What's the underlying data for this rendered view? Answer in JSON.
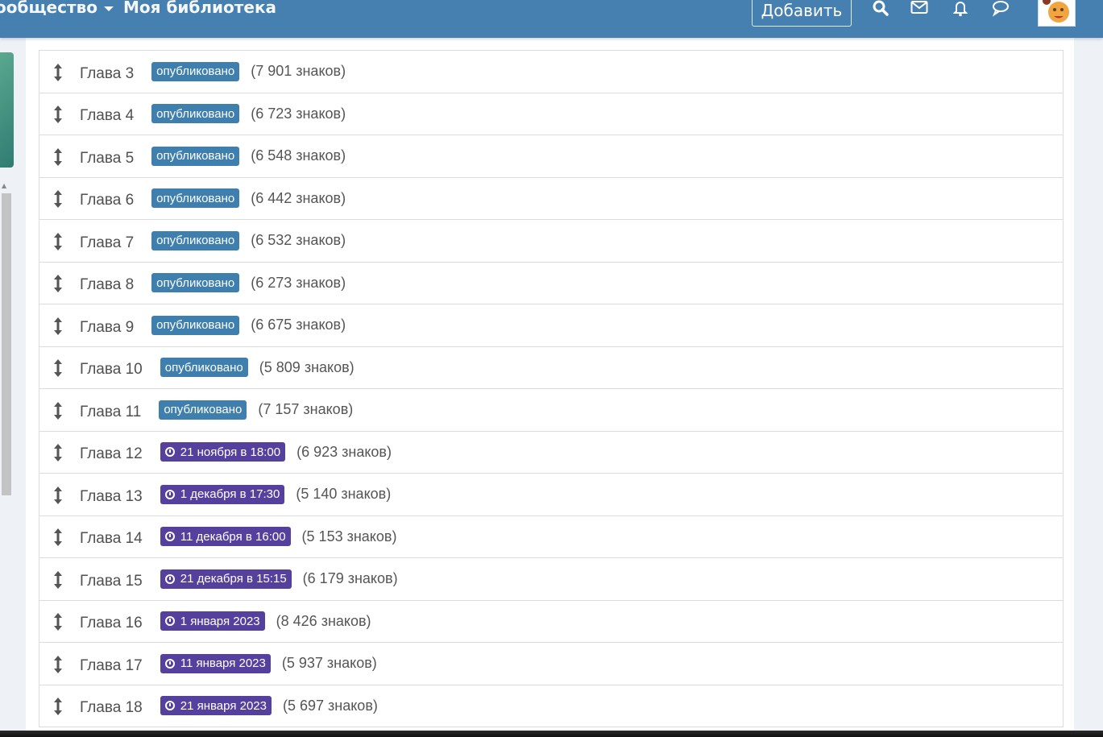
{
  "header": {
    "nav": [
      {
        "label": "ообщество",
        "has_dropdown": true
      },
      {
        "label": "Моя библиотека"
      }
    ],
    "add_button": "Добавить",
    "icons": [
      "search-icon",
      "mail-icon",
      "bell-icon",
      "chat-icon",
      "avatar"
    ]
  },
  "colors": {
    "header": "#4680b0",
    "published": "#3f7fae",
    "scheduled": "#55409e"
  },
  "chapters": [
    {
      "title": "Глава 3",
      "status": "опубликовано",
      "type": "pub",
      "chars": "(7 901 знаков)"
    },
    {
      "title": "Глава 4",
      "status": "опубликовано",
      "type": "pub",
      "chars": "(6 723 знаков)"
    },
    {
      "title": "Глава 5",
      "status": "опубликовано",
      "type": "pub",
      "chars": "(6 548 знаков)"
    },
    {
      "title": "Глава 6",
      "status": "опубликовано",
      "type": "pub",
      "chars": "(6 442 знаков)"
    },
    {
      "title": "Глава 7",
      "status": "опубликовано",
      "type": "pub",
      "chars": "(6 532 знаков)"
    },
    {
      "title": "Глава 8",
      "status": "опубликовано",
      "type": "pub",
      "chars": "(6 273 знаков)"
    },
    {
      "title": "Глава 9",
      "status": "опубликовано",
      "type": "pub",
      "chars": "(6 675 знаков)"
    },
    {
      "title": "Глава 10",
      "status": "опубликовано",
      "type": "pub",
      "chars": "(5 809 знаков)"
    },
    {
      "title": "Глава 11",
      "status": "опубликовано",
      "type": "pub",
      "chars": "(7 157 знаков)"
    },
    {
      "title": "Глава 12",
      "status": "21 ноября в 18:00",
      "type": "sched",
      "chars": "(6 923 знаков)"
    },
    {
      "title": "Глава 13",
      "status": "1 декабря в 17:30",
      "type": "sched",
      "chars": "(5 140 знаков)"
    },
    {
      "title": "Глава 14",
      "status": "11 декабря в 16:00",
      "type": "sched",
      "chars": "(5 153 знаков)"
    },
    {
      "title": "Глава 15",
      "status": "21 декабря в 15:15",
      "type": "sched",
      "chars": "(6 179 знаков)"
    },
    {
      "title": "Глава 16",
      "status": "1 января 2023",
      "type": "sched",
      "chars": "(8 426 знаков)"
    },
    {
      "title": "Глава 17",
      "status": "11 января 2023",
      "type": "sched",
      "chars": "(5 937 знаков)"
    },
    {
      "title": "Глава 18",
      "status": "21 января 2023",
      "type": "sched",
      "chars": "(5 697 знаков)"
    }
  ]
}
